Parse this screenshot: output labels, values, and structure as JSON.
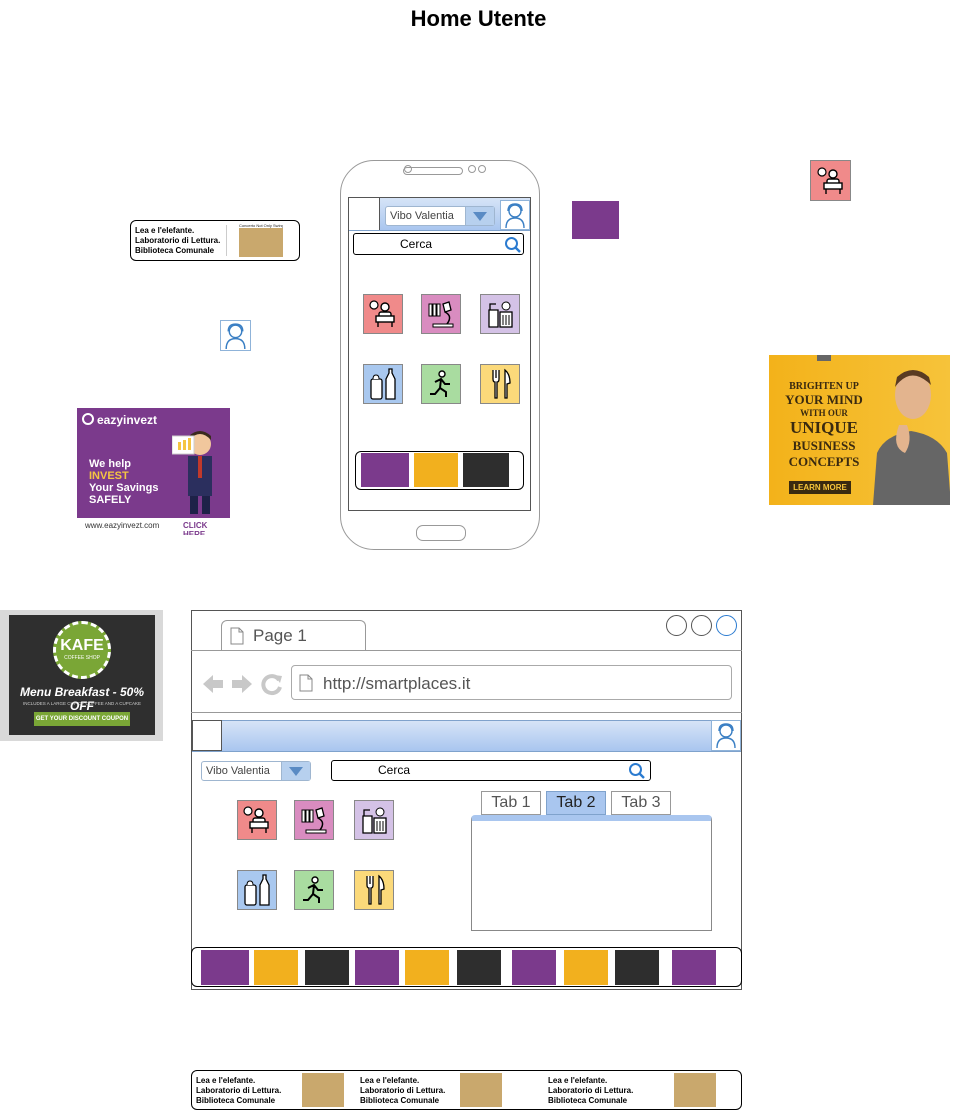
{
  "title": "Home Utente",
  "phone": {
    "city_select": "Vibo Valentia",
    "search_label": "Cerca"
  },
  "lea_ad": {
    "line1": "Lea e l'elefante.",
    "line2": "Laboratorio di Lettura.",
    "line3": "Biblioteca Comunale",
    "thumb_caption": "Concerto Not Only Swing"
  },
  "invest_ad": {
    "brand": "eazyinvezt",
    "line1": "We help",
    "line2": "INVEST",
    "line3": "Your Savings",
    "line4": "SAFELY",
    "url": "www.eazyinvezt.com",
    "cta": "CLICK HERE"
  },
  "business_ad": {
    "line1": "BRIGHTEN UP",
    "line2": "YOUR MIND",
    "line3": "WITH OUR",
    "line4": "UNIQUE",
    "line5": "BUSINESS",
    "line6": "CONCEPTS",
    "cta": "LEARN MORE"
  },
  "kafe_ad": {
    "brand": "KAFE",
    "sub": "COFFEE SHOP",
    "headline": "Menu Breakfast - 50% OFF",
    "small": "INCLUDES A LARGE CUP OF COFFEE AND A CUPCAKE",
    "cta": "GET YOUR DISCOUNT COUPON"
  },
  "browser": {
    "tab_label": "Page 1",
    "url": "http://smartplaces.it",
    "city_select": "Vibo Valentia",
    "search_label": "Cerca",
    "tabs": [
      "Tab 1",
      "Tab 2",
      "Tab 3"
    ],
    "active_tab": 1
  },
  "colors": {
    "accent_blue": "#b7d0ee",
    "tab_active": "#a9c6ef",
    "ad_purple": "#7b3a8c",
    "ad_yellow": "#f2b01e"
  }
}
